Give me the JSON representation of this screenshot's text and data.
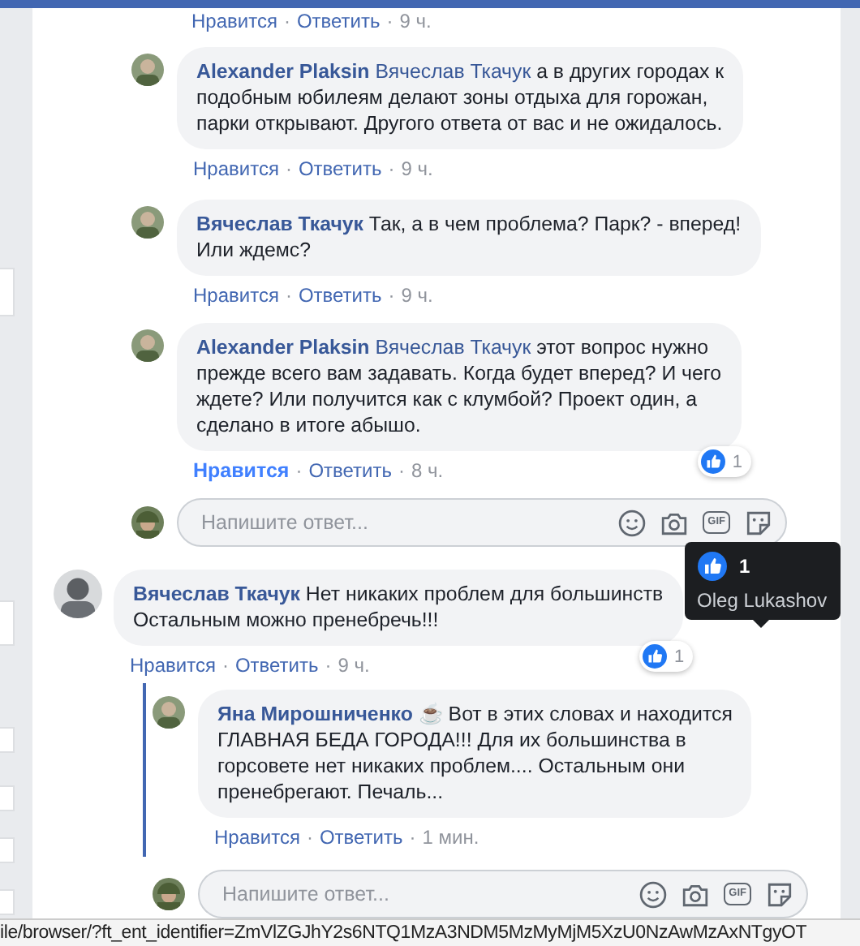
{
  "separator": "·",
  "top_actions": {
    "like": "Нравится",
    "reply": "Ответить",
    "time": "9 ч.",
    "liked": false
  },
  "replies": [
    {
      "kind": "comment",
      "author": "Alexander Plaksin",
      "mention": "Вячеслав Ткачук",
      "lines": [
        "а в других городах к",
        "подобным юбилеям делают зоны отдыха для горожан,",
        "парки открывают. Другого ответа от вас и не ожидалось."
      ],
      "like": "Нравится",
      "reply": "Ответить",
      "time": "9 ч.",
      "liked": false
    },
    {
      "kind": "comment",
      "author": "Вячеслав Ткачук",
      "lines": [
        "Так, а в чем проблема? Парк? - вперед!",
        "Или ждемс?"
      ],
      "like": "Нравится",
      "reply": "Ответить",
      "time": "9 ч.",
      "liked": false
    },
    {
      "kind": "comment",
      "author": "Alexander Plaksin",
      "mention": "Вячеслав Ткачук",
      "lines": [
        "этот вопрос нужно",
        "прежде всего вам задавать. Когда будет вперед? И чего",
        "ждете? Или получится как с клумбой? Проект один, а",
        "сделано в итоге абышо."
      ],
      "like": "Нравится",
      "reply": "Ответить",
      "time": "8 ч.",
      "liked": true,
      "reaction_count": "1"
    },
    {
      "kind": "reply_box",
      "placeholder": "Напишите ответ...",
      "gif_label": "GIF"
    }
  ],
  "comment": {
    "author": "Вячеслав Ткачук",
    "lines": [
      "Нет никаких проблем для большинств",
      "Остальным можно пренебречь!!!"
    ],
    "like": "Нравится",
    "reply": "Ответить",
    "time": "9 ч.",
    "liked": false,
    "reaction_count": "1",
    "tooltip": {
      "count": "1",
      "name": "Oleg Lukashov"
    },
    "replies": [
      {
        "kind": "comment",
        "author": "Яна Мирошниченко",
        "emoji": "☕",
        "lines": [
          "Вот в этих словах и находится",
          "ГЛАВНАЯ БЕДА ГОРОДА!!! Для их большинства в",
          "горсовете нет никаких проблем.... Остальным они",
          "пренебрегают. Печаль..."
        ],
        "like": "Нравится",
        "reply": "Ответить",
        "time": "1 мин.",
        "liked": false
      },
      {
        "kind": "reply_box",
        "placeholder": "Напишите ответ...",
        "gif_label": "GIF"
      }
    ]
  },
  "status_bar": {
    "url": "ile/browser/?ft_ent_identifier=ZmVlZGJhY2s6NTQ1MzA3NDM5MzMyMjM5XzU0NzAwMzAxNTgyOT"
  }
}
